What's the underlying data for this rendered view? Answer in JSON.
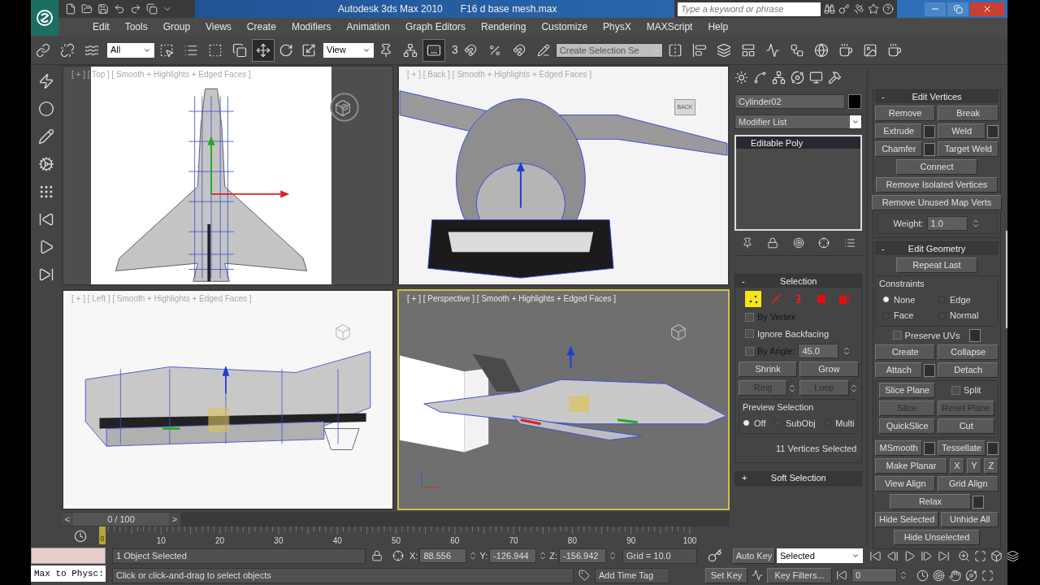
{
  "title_bar": {
    "app_title": "Autodesk 3ds Max 2010",
    "file_name": "F16 d base mesh.max",
    "search": {
      "placeholder": "Type a keyword or phrase"
    }
  },
  "menu": [
    "Edit",
    "Tools",
    "Group",
    "Views",
    "Create",
    "Modifiers",
    "Animation",
    "Graph Editors",
    "Rendering",
    "Customize",
    "PhysX",
    "MAXScript",
    "Help"
  ],
  "toolbar": {
    "selection_filter": "All",
    "reference_coord": "View",
    "snap_label": "3",
    "named_selection": {
      "placeholder": "Create Selection Se"
    },
    "transform_tools": [
      {
        "kind": "move",
        "selected": true
      },
      {
        "kind": "rotate",
        "selected": false
      },
      {
        "kind": "scale",
        "selected": false
      }
    ],
    "shortcut_override": {
      "on": true
    }
  },
  "viewports": [
    {
      "kind": "top",
      "label": "[ + ] [ Top ] [ Smooth + Highlights + Edged Faces ]",
      "active": false
    },
    {
      "kind": "back",
      "label": "[ + ] [ Back ] [ Smooth + Highlights + Edged Faces ]",
      "active": false,
      "viewcube_label": "BACK"
    },
    {
      "kind": "left",
      "label": "[ + ] [ Left ] [ Smooth + Highlights + Edged Faces ]",
      "active": false
    },
    {
      "kind": "perspective",
      "label": "[ + ] [ Perspective ] [ Smooth + Highlights + Edged Faces ]",
      "active": true
    }
  ],
  "time_slider": {
    "prev": "<",
    "label": "0 / 100",
    "next": ">",
    "level": 0
  },
  "track_bar": {
    "marker": "0",
    "labels": [
      "10",
      "20",
      "30",
      "40",
      "50",
      "60",
      "70",
      "80",
      "90",
      "100"
    ]
  },
  "command_panel": {
    "object_name": "Cylinder02",
    "modifier_list": "Modifier List",
    "stack": [
      {
        "label": "Editable Poly",
        "selected": true
      }
    ],
    "selection": {
      "sign": "-",
      "title": "Selection",
      "subobject_levels": [
        {
          "kind": "vertex",
          "selected": true
        },
        {
          "kind": "edge",
          "selected": false
        },
        {
          "kind": "border",
          "selected": false
        },
        {
          "kind": "polygon",
          "selected": false
        },
        {
          "kind": "element",
          "selected": false
        }
      ],
      "checkboxes": [
        {
          "label": "By Vertex",
          "checked": false,
          "disabled": true
        },
        {
          "label": "Ignore Backfacing",
          "checked": false,
          "disabled": false
        }
      ],
      "by_angle": {
        "label": "By Angle:",
        "checked": false,
        "disabled": true,
        "value": "45.0"
      },
      "buttons": [
        {
          "label": "Shrink",
          "disabled": false
        },
        {
          "label": "Grow",
          "disabled": false
        }
      ],
      "spin_buttons": [
        {
          "label": "Ring",
          "disabled": true
        },
        {
          "label": "Loop",
          "disabled": true
        }
      ],
      "preview": {
        "title": "Preview Selection",
        "options": [
          {
            "label": "Off",
            "selected": true
          },
          {
            "label": "SubObj",
            "selected": false
          },
          {
            "label": "Multi",
            "selected": false
          }
        ]
      },
      "status": "11 Vertices Selected"
    },
    "soft_selection": {
      "sign": "+",
      "title": "Soft Selection"
    },
    "edit_vertices": {
      "sign": "-",
      "title": "Edit Vertices",
      "rows": [
        [
          {
            "kind": "button",
            "label": "Remove",
            "settings": false,
            "disabled": false
          },
          {
            "kind": "button",
            "label": "Break",
            "settings": false,
            "disabled": false
          }
        ],
        [
          {
            "kind": "button",
            "label": "Extrude",
            "settings": true,
            "disabled": false
          },
          {
            "kind": "button",
            "label": "Weld",
            "settings": true,
            "disabled": false
          }
        ],
        [
          {
            "kind": "button",
            "label": "Chamfer",
            "settings": true,
            "disabled": false
          },
          {
            "kind": "button",
            "label": "Target Weld",
            "settings": false,
            "disabled": false
          }
        ],
        [
          {
            "kind": "button",
            "label": "Connect",
            "settings": false,
            "disabled": false
          }
        ],
        [
          {
            "kind": "button",
            "label": "Remove Isolated Vertices",
            "settings": false,
            "disabled": false
          }
        ],
        [
          {
            "kind": "button",
            "label": "Remove Unused Map Verts",
            "settings": false,
            "disabled": false
          }
        ]
      ],
      "weight": {
        "label": "Weight:",
        "value": "1.0"
      }
    },
    "edit_geometry": {
      "sign": "-",
      "title": "Edit Geometry",
      "repeat": [
        [
          {
            "kind": "button",
            "label": "Repeat Last",
            "settings": false,
            "disabled": false
          }
        ]
      ],
      "constraints": {
        "title": "Constraints",
        "options": [
          {
            "label": "None",
            "selected": true
          },
          {
            "label": "Edge",
            "selected": false
          },
          {
            "label": "Face",
            "selected": false
          },
          {
            "label": "Normal",
            "selected": false
          }
        ]
      },
      "rows_a": [
        [
          {
            "kind": "checkbox",
            "label": "Preserve UVs",
            "checked": false,
            "settings": true,
            "disabled": false
          }
        ],
        [
          {
            "kind": "button",
            "label": "Create",
            "settings": false,
            "disabled": false
          },
          {
            "kind": "button",
            "label": "Collapse",
            "settings": false,
            "disabled": false
          }
        ],
        [
          {
            "kind": "button",
            "label": "Attach",
            "settings": true,
            "disabled": false
          },
          {
            "kind": "button",
            "label": "Detach",
            "settings": false,
            "disabled": false
          }
        ]
      ],
      "slice_rows": [
        [
          {
            "kind": "button",
            "label": "Slice Plane",
            "settings": false,
            "disabled": false
          },
          {
            "kind": "checkbox",
            "label": "Split",
            "checked": false,
            "settings": false,
            "disabled": false
          }
        ],
        [
          {
            "kind": "button",
            "label": "Slice",
            "settings": false,
            "disabled": true
          },
          {
            "kind": "button",
            "label": "Reset Plane",
            "settings": false,
            "disabled": true
          }
        ],
        [
          {
            "kind": "button",
            "label": "QuickSlice",
            "settings": false,
            "disabled": false
          },
          {
            "kind": "button",
            "label": "Cut",
            "settings": false,
            "disabled": false
          }
        ]
      ],
      "rows_b": [
        [
          {
            "kind": "button",
            "label": "MSmooth",
            "settings": true,
            "disabled": false
          },
          {
            "kind": "button",
            "label": "Tessellate",
            "settings": true,
            "disabled": false
          }
        ],
        [
          {
            "kind": "button",
            "label": "Make Planar",
            "settings": false,
            "disabled": false
          },
          {
            "kind": "axis",
            "label": "X",
            "disabled": false
          },
          {
            "kind": "axis",
            "label": "Y",
            "disabled": false
          },
          {
            "kind": "axis",
            "label": "Z",
            "disabled": false
          }
        ],
        [
          {
            "kind": "button",
            "label": "View Align",
            "settings": false,
            "disabled": false
          },
          {
            "kind": "button",
            "label": "Grid Align",
            "settings": false,
            "disabled": false
          }
        ],
        [
          {
            "kind": "button",
            "label": "Relax",
            "settings": true,
            "disabled": false
          }
        ],
        [
          {
            "kind": "button",
            "label": "Hide Selected",
            "settings": false,
            "disabled": false
          },
          {
            "kind": "button",
            "label": "Unhide All",
            "settings": false,
            "disabled": false
          }
        ],
        [
          {
            "kind": "button",
            "label": "Hide Unselected",
            "settings": false,
            "disabled": false
          }
        ]
      ]
    }
  },
  "status_bar": {
    "listener": "Max to Physc:",
    "selection_info": "1 Object Selected",
    "prompt": "Click or click-and-drag to select objects",
    "coords": [
      {
        "label": "X:",
        "value": "88.556"
      },
      {
        "label": "Y:",
        "value": "-126.944"
      },
      {
        "label": "Z:",
        "value": "-156.942"
      }
    ],
    "grid": "Grid = 10.0",
    "time_tag": "Add Time Tag",
    "auto_key": "Auto Key",
    "key_mode": "Selected",
    "set_key": "Set Key",
    "key_filters": "Key Filters...",
    "frame": "0"
  }
}
